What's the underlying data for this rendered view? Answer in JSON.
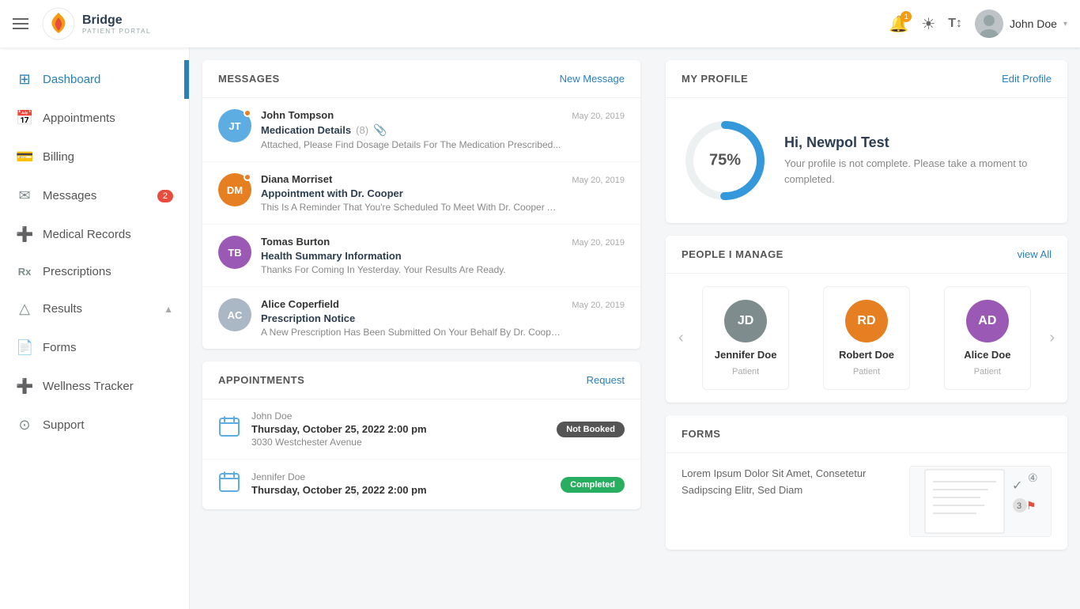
{
  "header": {
    "menu_icon": "☰",
    "logo_text": "Bridge",
    "logo_sub": "PATIENT PORTAL",
    "user_name": "John Doe",
    "user_chevron": "▾",
    "notification_count": "1"
  },
  "sidebar": {
    "items": [
      {
        "id": "dashboard",
        "label": "Dashboard",
        "icon": "⊞",
        "active": true,
        "badge": null
      },
      {
        "id": "appointments",
        "label": "Appointments",
        "icon": "📅",
        "active": false,
        "badge": null
      },
      {
        "id": "billing",
        "label": "Billing",
        "icon": "💳",
        "active": false,
        "badge": null
      },
      {
        "id": "messages",
        "label": "Messages",
        "icon": "✉",
        "active": false,
        "badge": "2"
      },
      {
        "id": "medical-records",
        "label": "Medical Records",
        "icon": "➕",
        "active": false,
        "badge": null
      },
      {
        "id": "prescriptions",
        "label": "Prescriptions",
        "icon": "Rx",
        "active": false,
        "badge": null
      },
      {
        "id": "results",
        "label": "Results",
        "icon": "△",
        "active": false,
        "badge": null,
        "arrow": "▲"
      },
      {
        "id": "forms",
        "label": "Forms",
        "icon": "📄",
        "active": false,
        "badge": null
      },
      {
        "id": "wellness-tracker",
        "label": "Wellness Tracker",
        "icon": "➕",
        "active": false,
        "badge": null
      },
      {
        "id": "support",
        "label": "Support",
        "icon": "⊙",
        "active": false,
        "badge": null
      }
    ]
  },
  "messages_section": {
    "title": "MESSAGES",
    "action_label": "New Message",
    "items": [
      {
        "id": "jt",
        "initials": "JT",
        "bg_color": "#5dade2",
        "online": true,
        "sender": "John Tompson",
        "date": "May 20, 2019",
        "subject": "Medication Details",
        "subject_count": "(8)",
        "has_attachment": true,
        "preview": "Attached, Please Find Dosage Details For The Medication Prescribed..."
      },
      {
        "id": "dm",
        "initials": "DM",
        "bg_color": "#e67e22",
        "online": true,
        "sender": "Diana Morriset",
        "date": "May 20, 2019",
        "subject": "Appointment with Dr. Cooper",
        "subject_count": null,
        "has_attachment": false,
        "preview": "This Is A Reminder That You're Scheduled To Meet With Dr. Cooper At..."
      },
      {
        "id": "tb",
        "initials": "TB",
        "bg_color": "#9b59b6",
        "online": false,
        "sender": "Tomas Burton",
        "date": "May 20, 2019",
        "subject": "Health Summary Information",
        "subject_count": null,
        "has_attachment": false,
        "preview": "Thanks For Coming In Yesterday.  Your Results Are Ready."
      },
      {
        "id": "ac",
        "initials": "AC",
        "bg_color": "#aab7c4",
        "online": false,
        "sender": "Alice Coperfield",
        "date": "May 20, 2019",
        "subject": "Prescription Notice",
        "subject_count": null,
        "has_attachment": false,
        "preview": "A New Prescription Has Been Submitted On Your Behalf By Dr. Cooper."
      }
    ]
  },
  "appointments_section": {
    "title": "APPOINTMENTS",
    "action_label": "Request",
    "items": [
      {
        "patient": "John Doe",
        "date": "Thursday, October 25, 2022 2:00 pm",
        "address": "3030 Westchester Avenue",
        "status": "Not Booked",
        "status_type": "not-booked"
      },
      {
        "patient": "Jennifer Doe",
        "date": "Thursday, October 25, 2022 2:00 pm",
        "address": "",
        "status": "Completed",
        "status_type": "completed"
      }
    ]
  },
  "profile_section": {
    "title": "MY PROFILE",
    "action_label": "Edit Profile",
    "percentage": "75%",
    "greeting": "Hi, Newpol Test",
    "message": "Your profile is not complete. Please take a moment to completed."
  },
  "people_section": {
    "title": "PEOPLE I MANAGE",
    "action_label": "view All",
    "people": [
      {
        "initials": "JD",
        "bg_color": "#7f8c8d",
        "name": "Jennifer Doe",
        "role": "Patient"
      },
      {
        "initials": "RD",
        "bg_color": "#e67e22",
        "name": "Robert Doe",
        "role": "Patient"
      },
      {
        "initials": "AD",
        "bg_color": "#9b59b6",
        "name": "Alice Doe",
        "role": "Patient"
      }
    ]
  },
  "forms_section": {
    "title": "FORMS",
    "text": "Lorem Ipsum Dolor Sit Amet, Consetetur Sadipscing Elitr, Sed Diam"
  }
}
